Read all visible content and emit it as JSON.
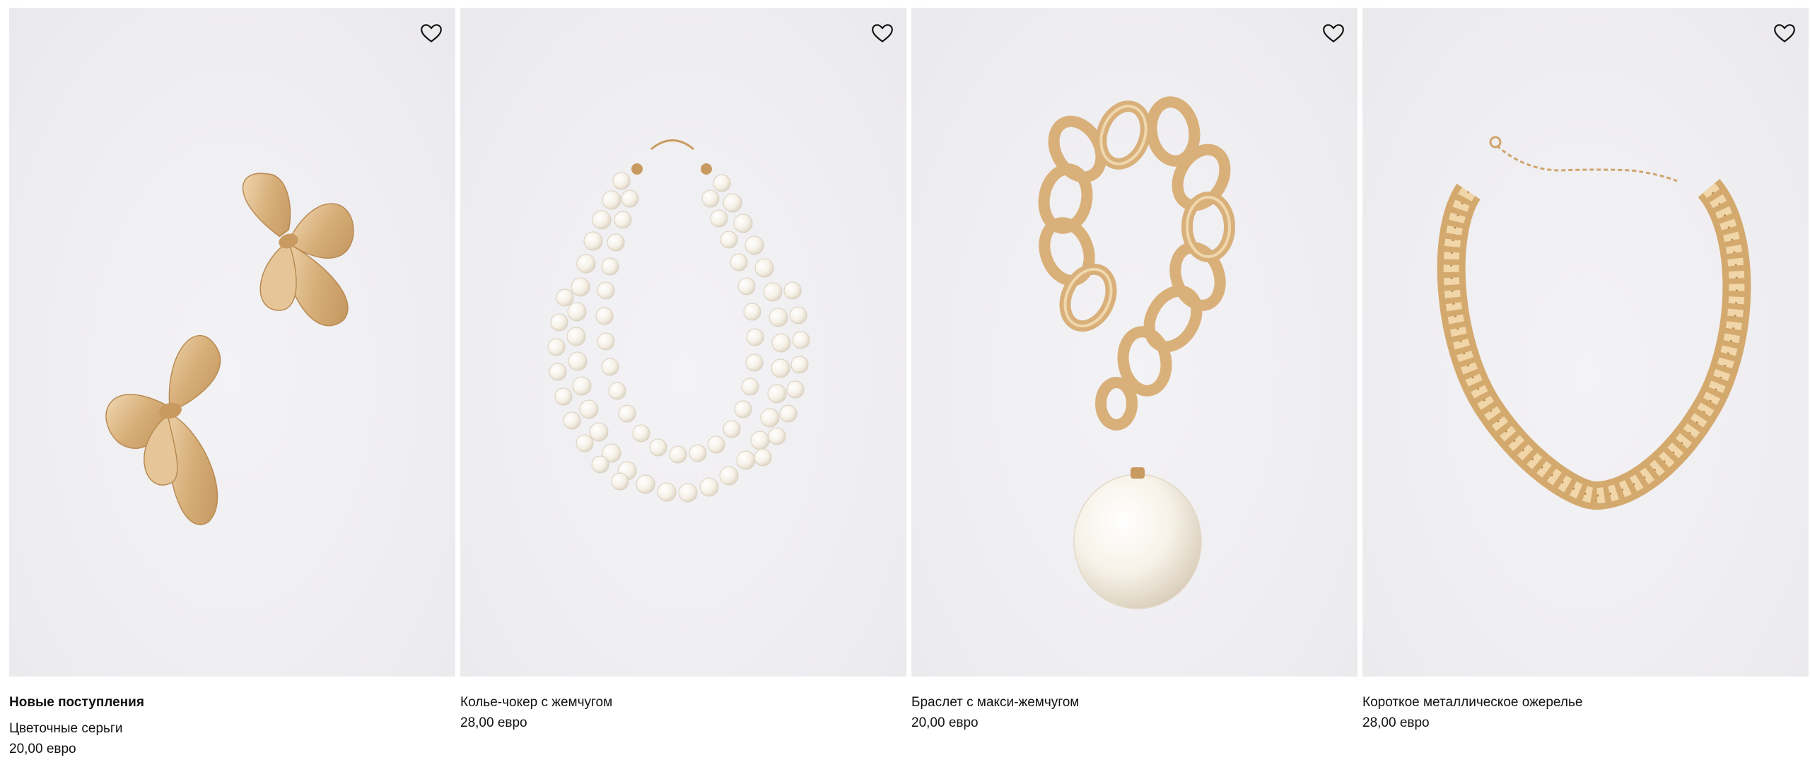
{
  "section": {
    "title": "Новые поступления"
  },
  "products": [
    {
      "name": "Цветочные серьги",
      "price": "20,00 евро",
      "image": "flower-earrings-photo",
      "wishlist_icon": "heart-outline-icon"
    },
    {
      "name": "Колье-чокер с жемчугом",
      "price": "28,00 евро",
      "image": "pearl-choker-photo",
      "wishlist_icon": "heart-outline-icon"
    },
    {
      "name": "Браслет с макси-жемчугом",
      "price": "20,00 евро",
      "image": "chain-bracelet-pearl-photo",
      "wishlist_icon": "heart-outline-icon"
    },
    {
      "name": "Короткое металлическое ожерелье",
      "price": "28,00 евро",
      "image": "short-metal-necklace-photo",
      "wishlist_icon": "heart-outline-icon"
    }
  ],
  "colors": {
    "background": "#ffffff",
    "photo_background": "#efeef1",
    "gold": "#d9b27a",
    "pearl": "#f7f3ea",
    "text": "#111111"
  }
}
